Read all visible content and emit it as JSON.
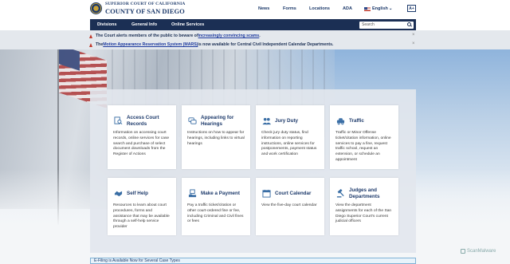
{
  "header": {
    "logo_line1": "SUPERIOR COURT OF CALIFORNIA",
    "logo_line2": "COUNTY OF SAN DIEGO",
    "links": [
      "News",
      "Forms",
      "Locations",
      "ADA"
    ],
    "language": "English",
    "text_size": "A+"
  },
  "navbar": {
    "items": [
      "Divisions",
      "General Info",
      "Online Services"
    ],
    "search_placeholder": "Search"
  },
  "alerts": [
    {
      "prefix": "The Court alerts members of the public to beware of ",
      "link": "increasingly convincing scams",
      "suffix": "."
    },
    {
      "prefix": "The ",
      "link": "Motion Appearance Reservation System (MARS)",
      "suffix": " is now available for Central Civil Independent Calendar Departments."
    }
  ],
  "cards": [
    {
      "title": "Access Court Records",
      "icon": "search-doc-icon",
      "desc": "Information on accessing court records, online services for case search and purchase of select document downloads from the Register of Actions"
    },
    {
      "title": "Appearing for Hearings",
      "icon": "chat-icon",
      "desc": "Instructions on how to appear for hearings, including links to virtual hearings"
    },
    {
      "title": "Jury Duty",
      "icon": "users-icon",
      "desc": "Check jury duty status, find information on reporting instructions, online services for postponements, payment status and work certification"
    },
    {
      "title": "Traffic",
      "icon": "car-icon",
      "desc": "Traffic or Minor Offense ticket/citation information, online services to pay a fine, request traffic school, request an extension, or schedule an appointment"
    },
    {
      "title": "Self Help",
      "icon": "handshake-icon",
      "desc": "Resources to learn about court procedures, forms and assistance that may be available through a self-help service provider"
    },
    {
      "title": "Make a Payment",
      "icon": "payment-icon",
      "desc": "Pay a traffic ticket/citation or other court-ordered fine or fee, including Criminal and Civil fines or fees"
    },
    {
      "title": "Court Calendar",
      "icon": "calendar-icon",
      "desc": "View the five-day court calendar"
    },
    {
      "title": "Judges and Departments",
      "icon": "gavel-icon",
      "desc": "View the department assignments for each of the San Diego Superior Court's current judicial officers"
    }
  ],
  "bottom_bar": "E-Filing is Available Now for Several Case Types",
  "watermark": "ScanMalware",
  "colors": {
    "navy": "#1b2f54",
    "accent": "#1d3a6b",
    "alert": "#c0392b"
  }
}
